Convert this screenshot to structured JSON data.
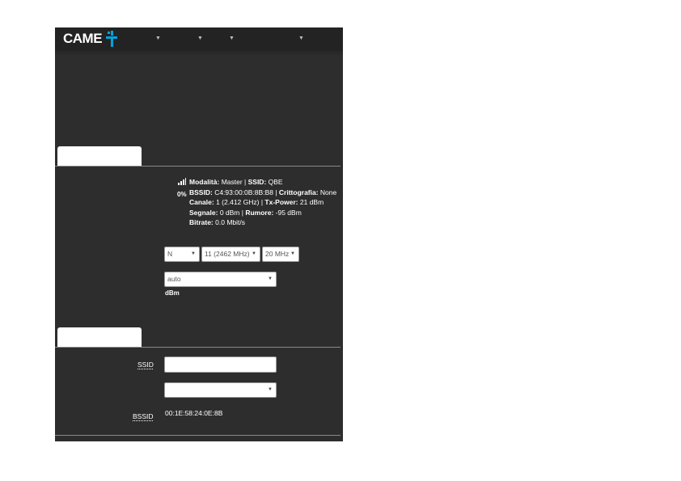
{
  "header": {
    "logo_text": "CAME",
    "brand_color": "#00a3e0",
    "menus": [
      {
        "label": "",
        "icon": "caret-down-icon"
      },
      {
        "label": "",
        "icon": "caret-down-icon"
      },
      {
        "label": "",
        "icon": "caret-down-icon"
      },
      {
        "label": "",
        "icon": "caret-down-icon"
      }
    ]
  },
  "status": {
    "signal_icon": "signal-bars-icon",
    "signal_percent": "0%",
    "mode_label": "Modalità:",
    "mode_value": "Master",
    "ssid_label": "SSID:",
    "ssid_value": "QBE",
    "bssid_label": "BSSID:",
    "bssid_value": "C4:93:00:0B:8B:B8",
    "encryption_label": "Crittografia:",
    "encryption_value": "None",
    "channel_label": "Canale:",
    "channel_value": "1 (2.412 GHz)",
    "txpower_label": "Tx-Power:",
    "txpower_value": "21 dBm",
    "signal_label": "Segnale:",
    "signal_value": "0 dBm",
    "noise_label": "Rumore:",
    "noise_value": "-95 dBm",
    "bitrate_label": "Bitrate:",
    "bitrate_value": "0.0 Mbit/s"
  },
  "device_config": {
    "mode_select": "N",
    "channel_select": "11 (2462 MHz)",
    "width_select": "20 MHz",
    "txpower_select": "auto",
    "txpower_unit": "dBm"
  },
  "interface_config": {
    "ssid_label": "SSID",
    "ssid_value": "",
    "mode_select": "",
    "bssid_label": "BSSID",
    "bssid_value": "00:1E:58:24:0E:8B"
  }
}
